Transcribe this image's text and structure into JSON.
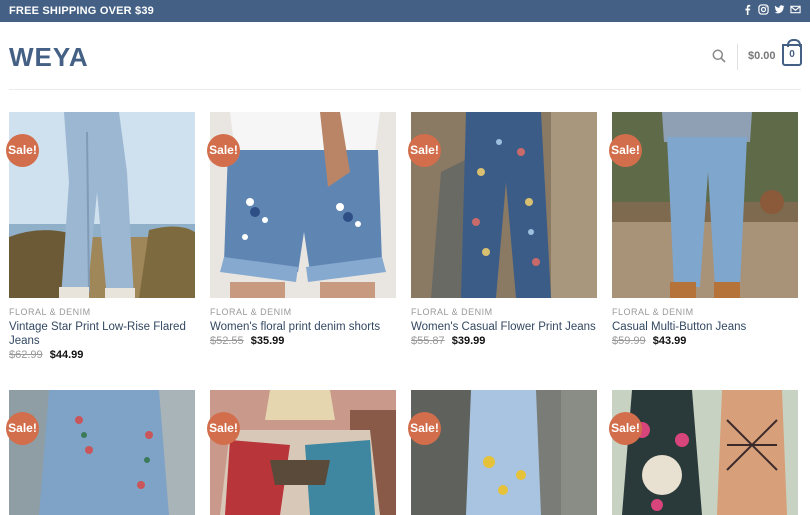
{
  "topbar": {
    "shipping_text": "FREE SHIPPING OVER $39",
    "social_icons": [
      "facebook-icon",
      "instagram-icon",
      "twitter-icon",
      "mail-icon"
    ]
  },
  "header": {
    "logo": "WEYA",
    "cart_total": "$0.00",
    "cart_count": "0"
  },
  "colors": {
    "brand": "#446084",
    "sale_badge": "#d26e4b",
    "link": "#334862"
  },
  "products": [
    {
      "badge": "Sale!",
      "category": "FLORAL & DENIM",
      "name": "Vintage Star Print Low-Rise Flared Jeans",
      "old_price": "$62.99",
      "price": "$44.99"
    },
    {
      "badge": "Sale!",
      "category": "FLORAL & DENIM",
      "name": "Women's floral print denim shorts",
      "old_price": "$52.55",
      "price": "$35.99"
    },
    {
      "badge": "Sale!",
      "category": "FLORAL & DENIM",
      "name": "Women's Casual Flower Print Jeans",
      "old_price": "$55.87",
      "price": "$39.99"
    },
    {
      "badge": "Sale!",
      "category": "FLORAL & DENIM",
      "name": "Casual Multi-Button Jeans",
      "old_price": "$59.99",
      "price": "$43.99"
    },
    {
      "badge": "Sale!"
    },
    {
      "badge": "Sale!"
    },
    {
      "badge": "Sale!"
    },
    {
      "badge": "Sale!"
    }
  ]
}
